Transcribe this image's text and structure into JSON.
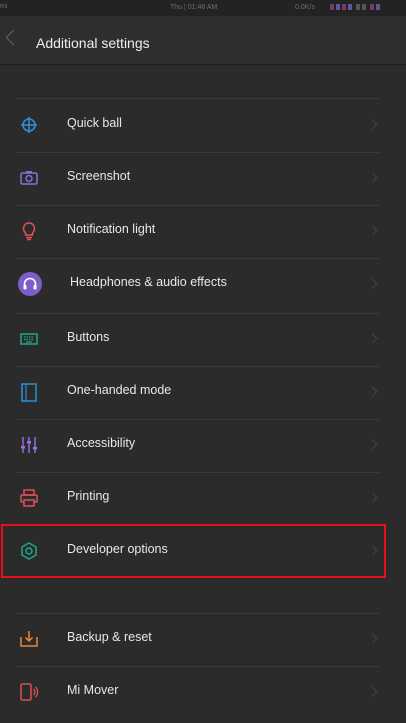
{
  "status_bar": {
    "carrier": "mi",
    "time": "Thu | 01:46 AM",
    "network_speed": "0.0K/s"
  },
  "header": {
    "title": "Additional settings"
  },
  "items": [
    {
      "label": "Quick ball",
      "icon": "crosshair-icon",
      "color": "#2e8fd9"
    },
    {
      "label": "Screenshot",
      "icon": "camera-icon",
      "color": "#8a70d6"
    },
    {
      "label": "Notification light",
      "icon": "lightbulb-icon",
      "color": "#e0505a"
    },
    {
      "label": "Headphones & audio effects",
      "icon": "headphones-icon",
      "color": "#7b5ec8"
    },
    {
      "label": "Buttons",
      "icon": "keyboard-icon",
      "color": "#1fa88a"
    },
    {
      "label": "One-handed mode",
      "icon": "tablet-icon",
      "color": "#2a8dd2"
    },
    {
      "label": "Accessibility",
      "icon": "sliders-icon",
      "color": "#9b6fe0"
    },
    {
      "label": "Printing",
      "icon": "printer-icon",
      "color": "#e0505a"
    },
    {
      "label": "Developer options",
      "icon": "hexagon-gear-icon",
      "color": "#1fa88a"
    },
    {
      "label": "Backup & reset",
      "icon": "download-box-icon",
      "color": "#e8873a"
    },
    {
      "label": "Mi Mover",
      "icon": "phone-waves-icon",
      "color": "#e0505a"
    }
  ],
  "highlight_color": "#e8101d"
}
